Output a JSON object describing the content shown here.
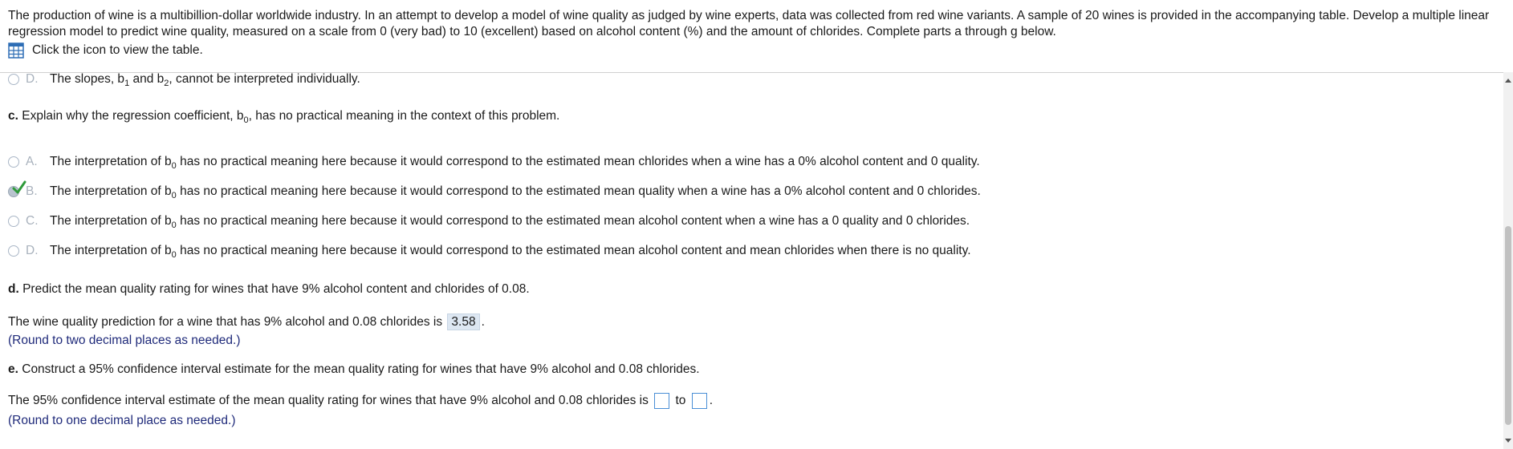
{
  "header": {
    "intro_text": "The production of wine is a multibillion-dollar worldwide industry. In an attempt to develop a model of wine quality as judged by wine experts, data was collected from red wine variants. A sample of 20 wines is provided in the accompanying table. Develop a multiple linear regression  model to predict wine quality, measured on a scale from 0 (very bad) to 10 (excellent) based on alcohol content (%) and the amount of chlorides. Complete parts a through g below.",
    "table_link_label": "Click the icon to view the table."
  },
  "prev_option_d": {
    "letter": "D.",
    "pre": "The slopes, b",
    "sub1": "1",
    "mid": " and b",
    "sub2": "2",
    "post": ", cannot be interpreted individually."
  },
  "part_c": {
    "label": "c.",
    "question_pre": " Explain why the regression coefficient, b",
    "question_sub": "0",
    "question_post": ", has no practical meaning in the context of this problem.",
    "options": [
      {
        "letter": "A.",
        "pre": "The interpretation of b",
        "sub": "0",
        "post": " has no practical meaning here because it would correspond to the estimated mean chlorides when a wine has a 0% alcohol content and 0 quality."
      },
      {
        "letter": "B.",
        "pre": "The interpretation of b",
        "sub": "0",
        "post": " has no practical meaning here because it would correspond to the estimated mean quality when a wine has a 0% alcohol content and 0 chlorides."
      },
      {
        "letter": "C.",
        "pre": "The interpretation of b",
        "sub": "0",
        "post": " has no practical meaning here because it would correspond to the estimated mean alcohol content when a wine has a 0 quality and 0 chlorides."
      },
      {
        "letter": "D.",
        "pre": "The interpretation of b",
        "sub": "0",
        "post": " has no practical meaning here because it would correspond to the estimated mean alcohol content and mean chlorides when there is no quality."
      }
    ],
    "selected": "B"
  },
  "part_d": {
    "label": "d.",
    "question": " Predict the mean quality rating for wines that have 9% alcohol content and chlorides of 0.08.",
    "answer_pre": "The wine quality prediction for a wine that has 9% alcohol and 0.08 chlorides is ",
    "answer_value": "3.58",
    "answer_post": ".",
    "note": "(Round to two decimal places as needed.)"
  },
  "part_e": {
    "label": "e.",
    "question": " Construct a 95% confidence interval estimate for the mean quality rating for wines that have 9% alcohol and 0.08 chlorides.",
    "answer_pre": "The 95% confidence interval estimate of the mean quality rating for wines that have 9% alcohol and 0.08 chlorides is ",
    "answer_mid": " to ",
    "answer_post": ".",
    "lower_value": "",
    "upper_value": "",
    "note": "(Round to one decimal place as needed.)"
  },
  "colors": {
    "accent_blue": "#4a8fd6",
    "note_text": "#1f2a7a",
    "check_green": "#2e9a3a",
    "answer_box_bg": "#dde7f2"
  }
}
